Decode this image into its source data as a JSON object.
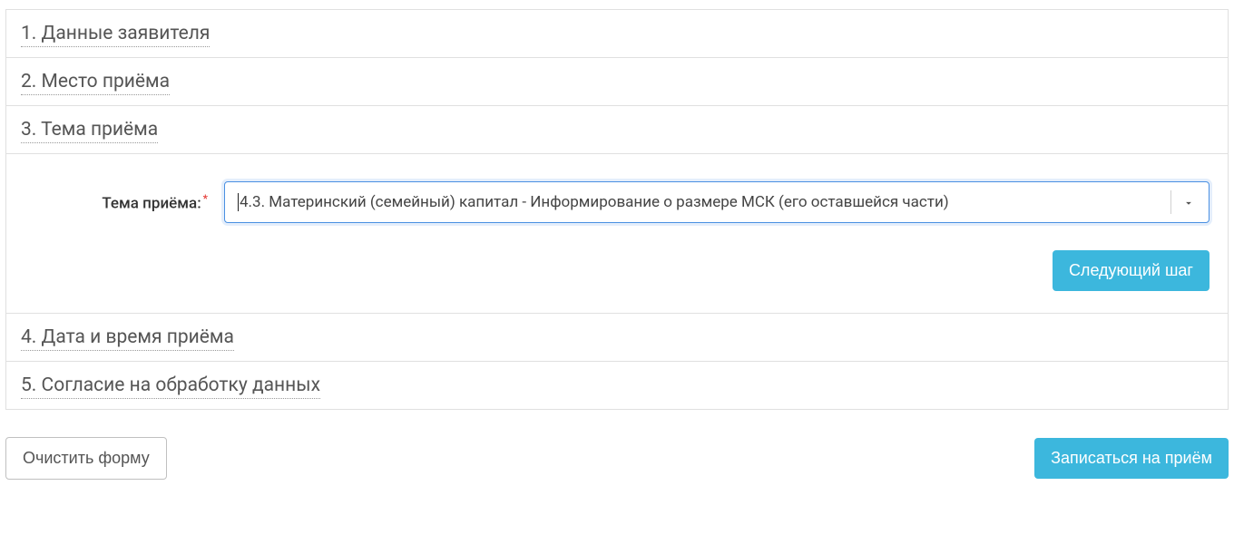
{
  "steps": {
    "s1": "1. Данные заявителя",
    "s2": "2. Место приёма",
    "s3": "3. Тема приёма",
    "s4": "4. Дата и время приёма",
    "s5": "5. Согласие на обработку данных"
  },
  "form": {
    "topic_label": "Тема приёма:",
    "topic_value": "4.3. Материнский (семейный) капитал - Информирование о размере МСК (его оставшейся части)"
  },
  "buttons": {
    "next": "Следующий шаг",
    "clear": "Очистить форму",
    "submit": "Записаться на приём"
  }
}
